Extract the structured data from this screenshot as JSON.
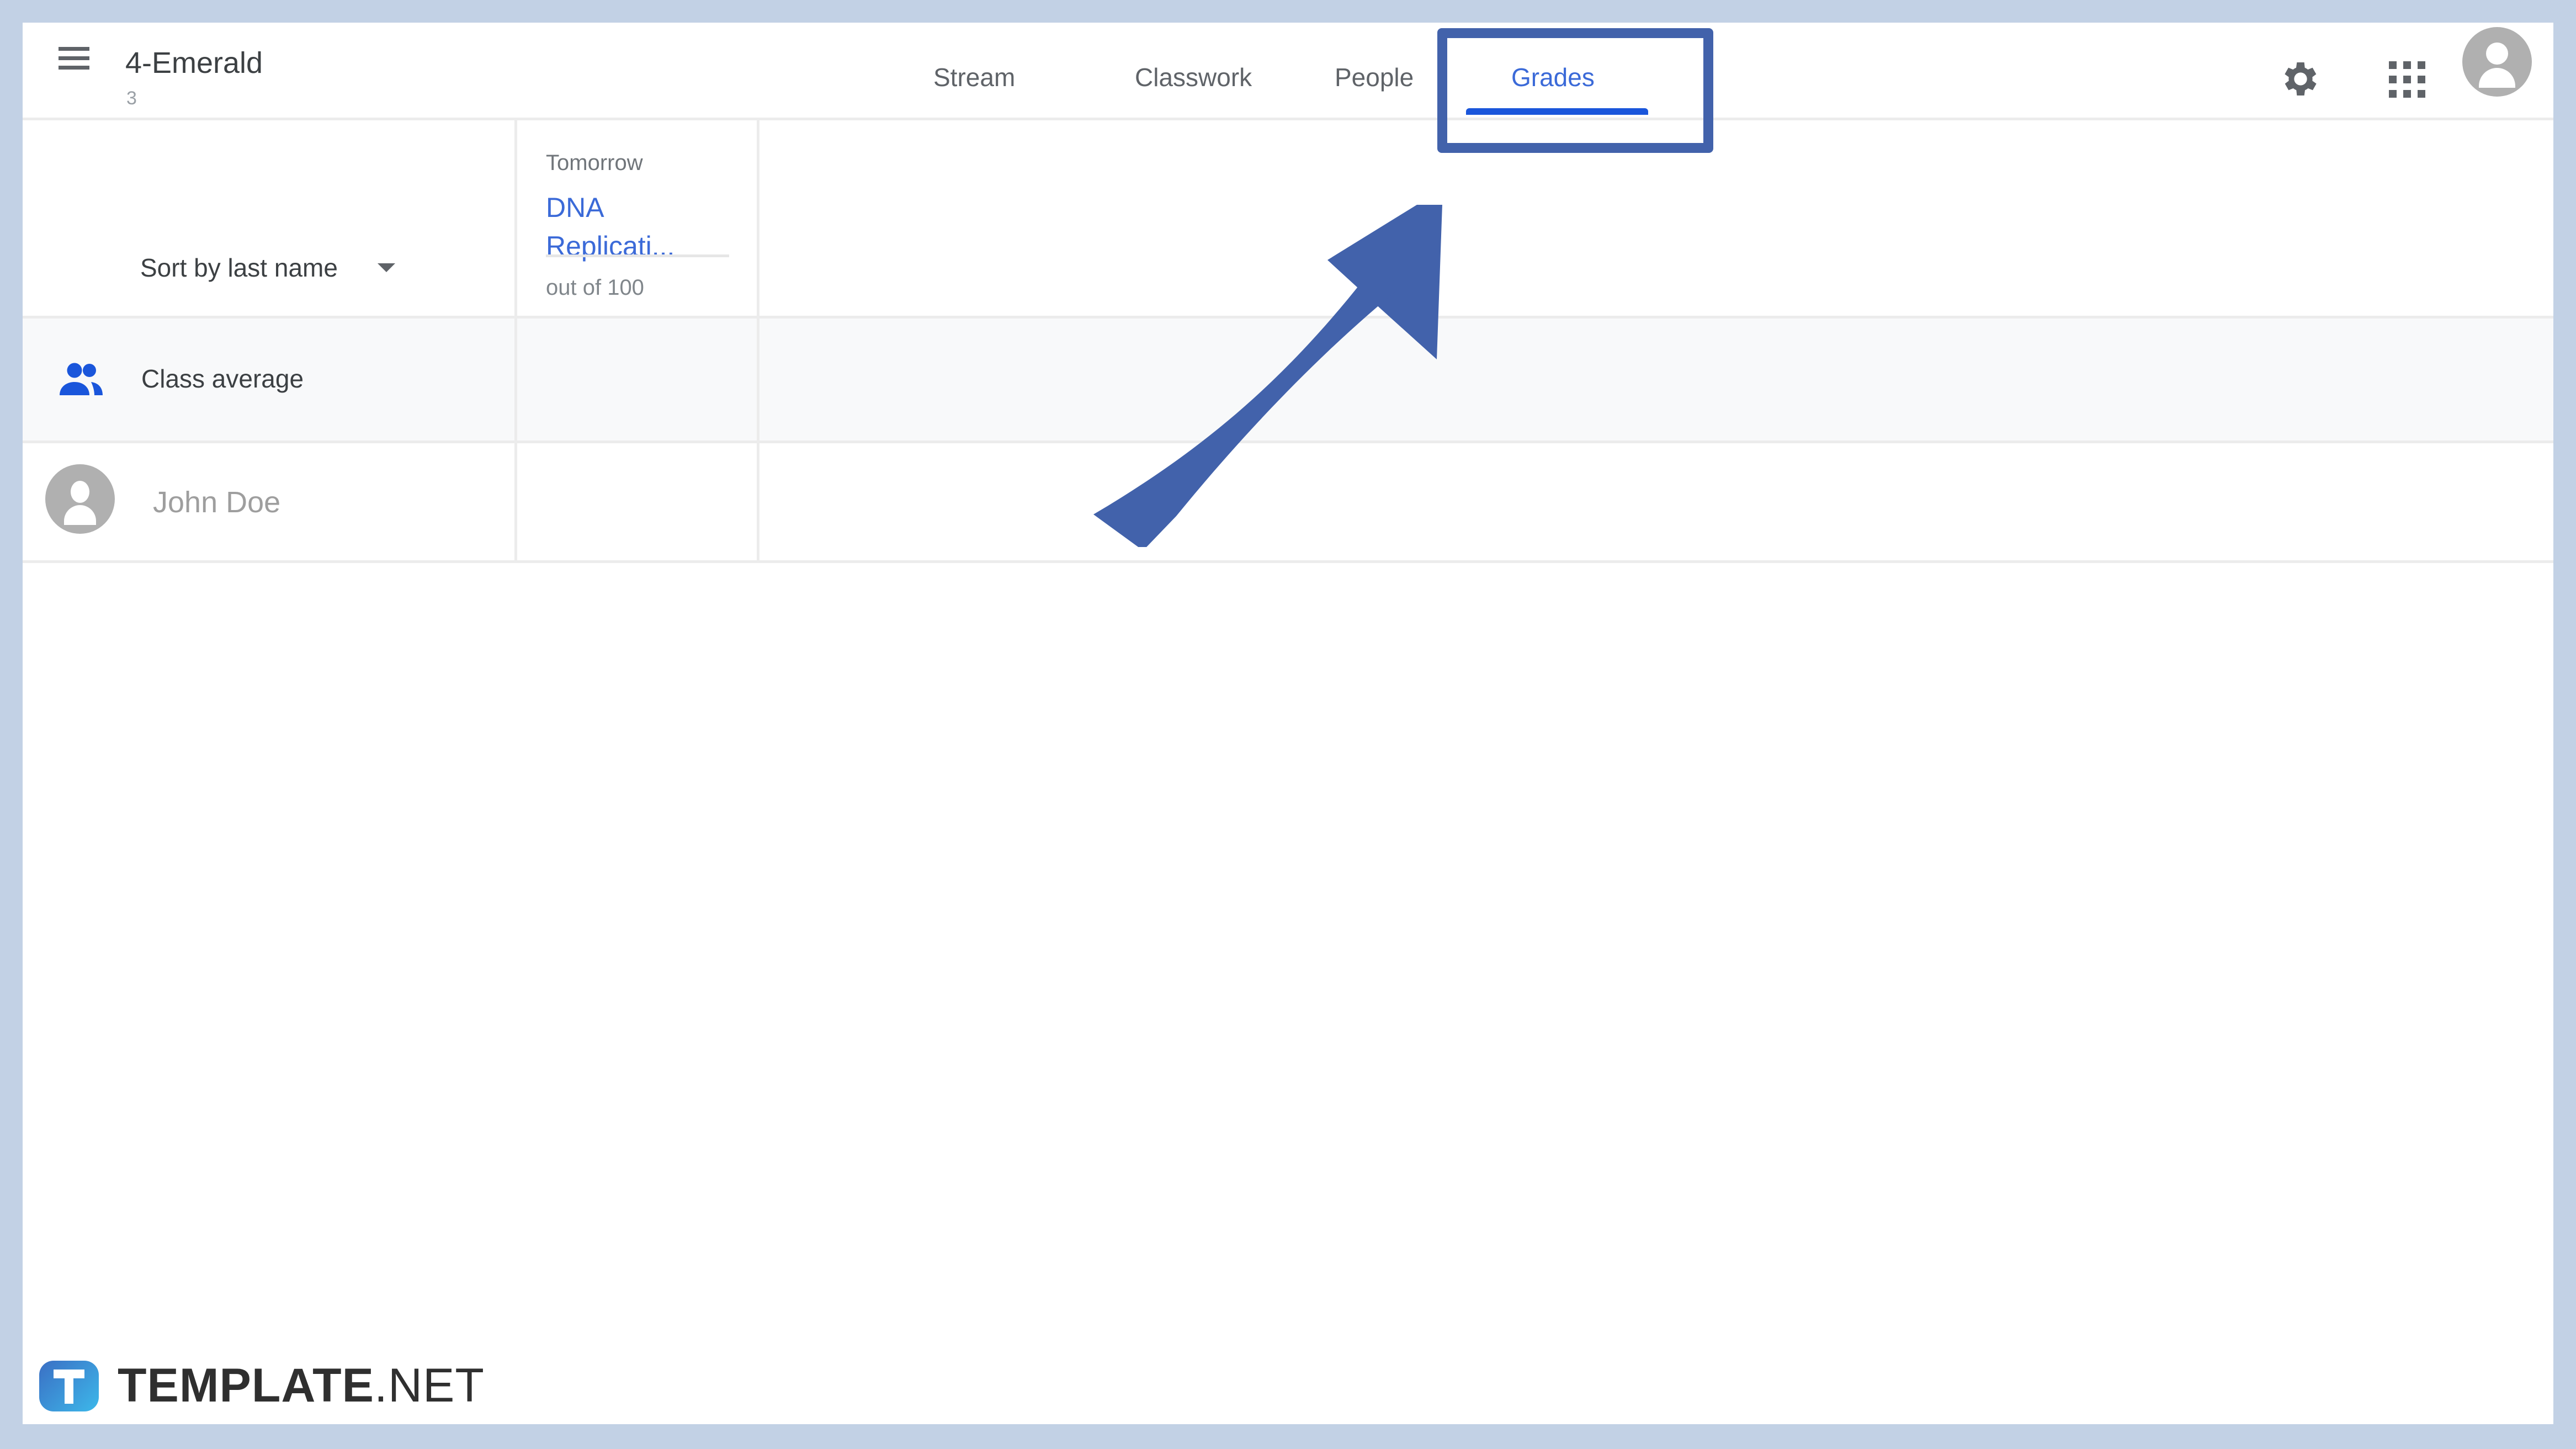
{
  "header": {
    "class_name": "4-Emerald",
    "class_section": "3",
    "tabs": [
      {
        "label": "Stream",
        "active": false
      },
      {
        "label": "Classwork",
        "active": false
      },
      {
        "label": "People",
        "active": false
      },
      {
        "label": "Grades",
        "active": true
      }
    ],
    "icons": [
      "menu-icon",
      "settings-gear-icon",
      "apps-grid-icon",
      "account-avatar-icon"
    ]
  },
  "grades_table": {
    "sort_label": "Sort by last name",
    "assignments": [
      {
        "due": "Tomorrow",
        "title": "DNA Replicati...",
        "max_points": "out of 100"
      }
    ],
    "class_average_label": "Class average",
    "students": [
      {
        "name": "John Doe",
        "grades": [
          ""
        ]
      }
    ]
  },
  "annotation": {
    "highlight_target": "Grades",
    "color": "#4262ab"
  },
  "watermark": {
    "brand_bold": "TEMPLATE",
    "brand_light": ".NET",
    "icon_letter": "T"
  },
  "colors": {
    "accent": "#3b6ad8",
    "frame": "#c2d1e5",
    "annotation": "#4262ab"
  }
}
